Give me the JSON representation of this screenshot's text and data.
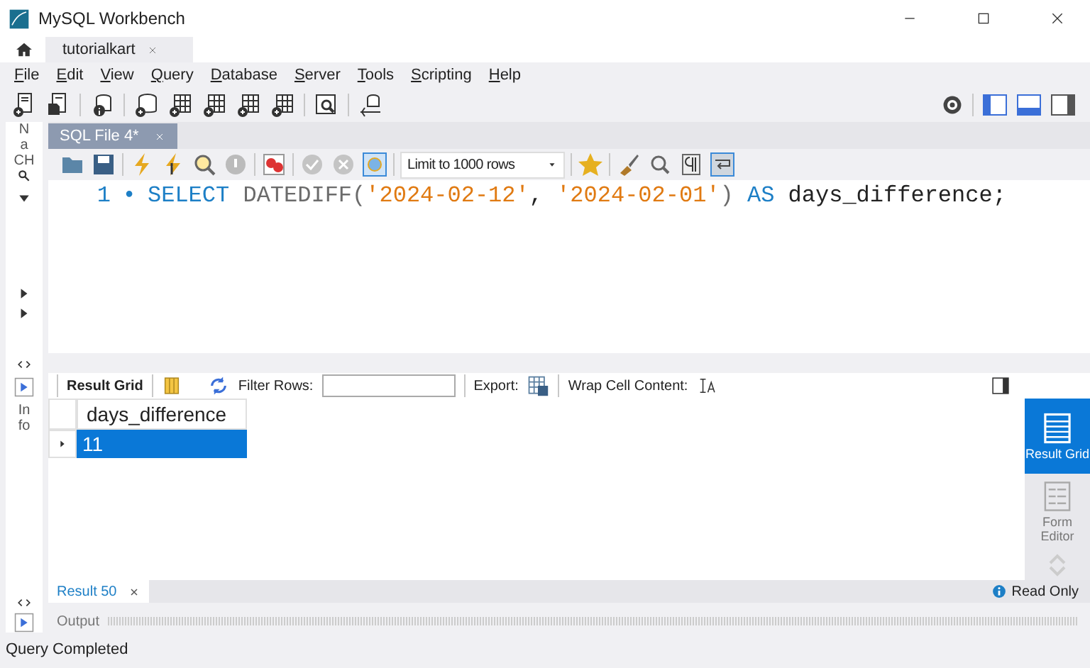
{
  "window": {
    "title": "MySQL Workbench"
  },
  "connection_tabs": [
    {
      "label": "tutorialkart",
      "selected": true
    }
  ],
  "menu": [
    "File",
    "Edit",
    "View",
    "Query",
    "Database",
    "Server",
    "Tools",
    "Scripting",
    "Help"
  ],
  "sidebar": {
    "labels": [
      "N",
      "a",
      "CH"
    ],
    "info_labels": [
      "In",
      "fo"
    ]
  },
  "editor": {
    "tab": {
      "label": "SQL File 4*"
    },
    "limit": "Limit to 1000 rows",
    "lines": [
      {
        "number": "1",
        "marker": "•",
        "tokens": [
          {
            "kind": "keyword",
            "text": "SELECT "
          },
          {
            "kind": "function",
            "text": "DATEDIFF("
          },
          {
            "kind": "string",
            "text": "'2024-02-12'"
          },
          {
            "kind": "plain",
            "text": ", "
          },
          {
            "kind": "string",
            "text": "'2024-02-01'"
          },
          {
            "kind": "function",
            "text": ") "
          },
          {
            "kind": "keyword",
            "text": "AS "
          },
          {
            "kind": "plain",
            "text": "days_difference;"
          }
        ]
      }
    ]
  },
  "results": {
    "toolbar": {
      "result_grid": "Result Grid",
      "filter_label": "Filter Rows:",
      "export_label": "Export:",
      "wrap_label": "Wrap Cell Content:"
    },
    "columns": [
      "days_difference"
    ],
    "rows": [
      {
        "cells": [
          "11"
        ],
        "selected": true
      }
    ],
    "side_panel": [
      {
        "label": "Result Grid",
        "selected": true
      },
      {
        "label": "Form Editor",
        "selected": false
      }
    ],
    "tab": {
      "label": "Result 50",
      "selected": true
    },
    "read_only": "Read Only"
  },
  "output": {
    "label": "Output"
  },
  "status_bar": "Query Completed"
}
